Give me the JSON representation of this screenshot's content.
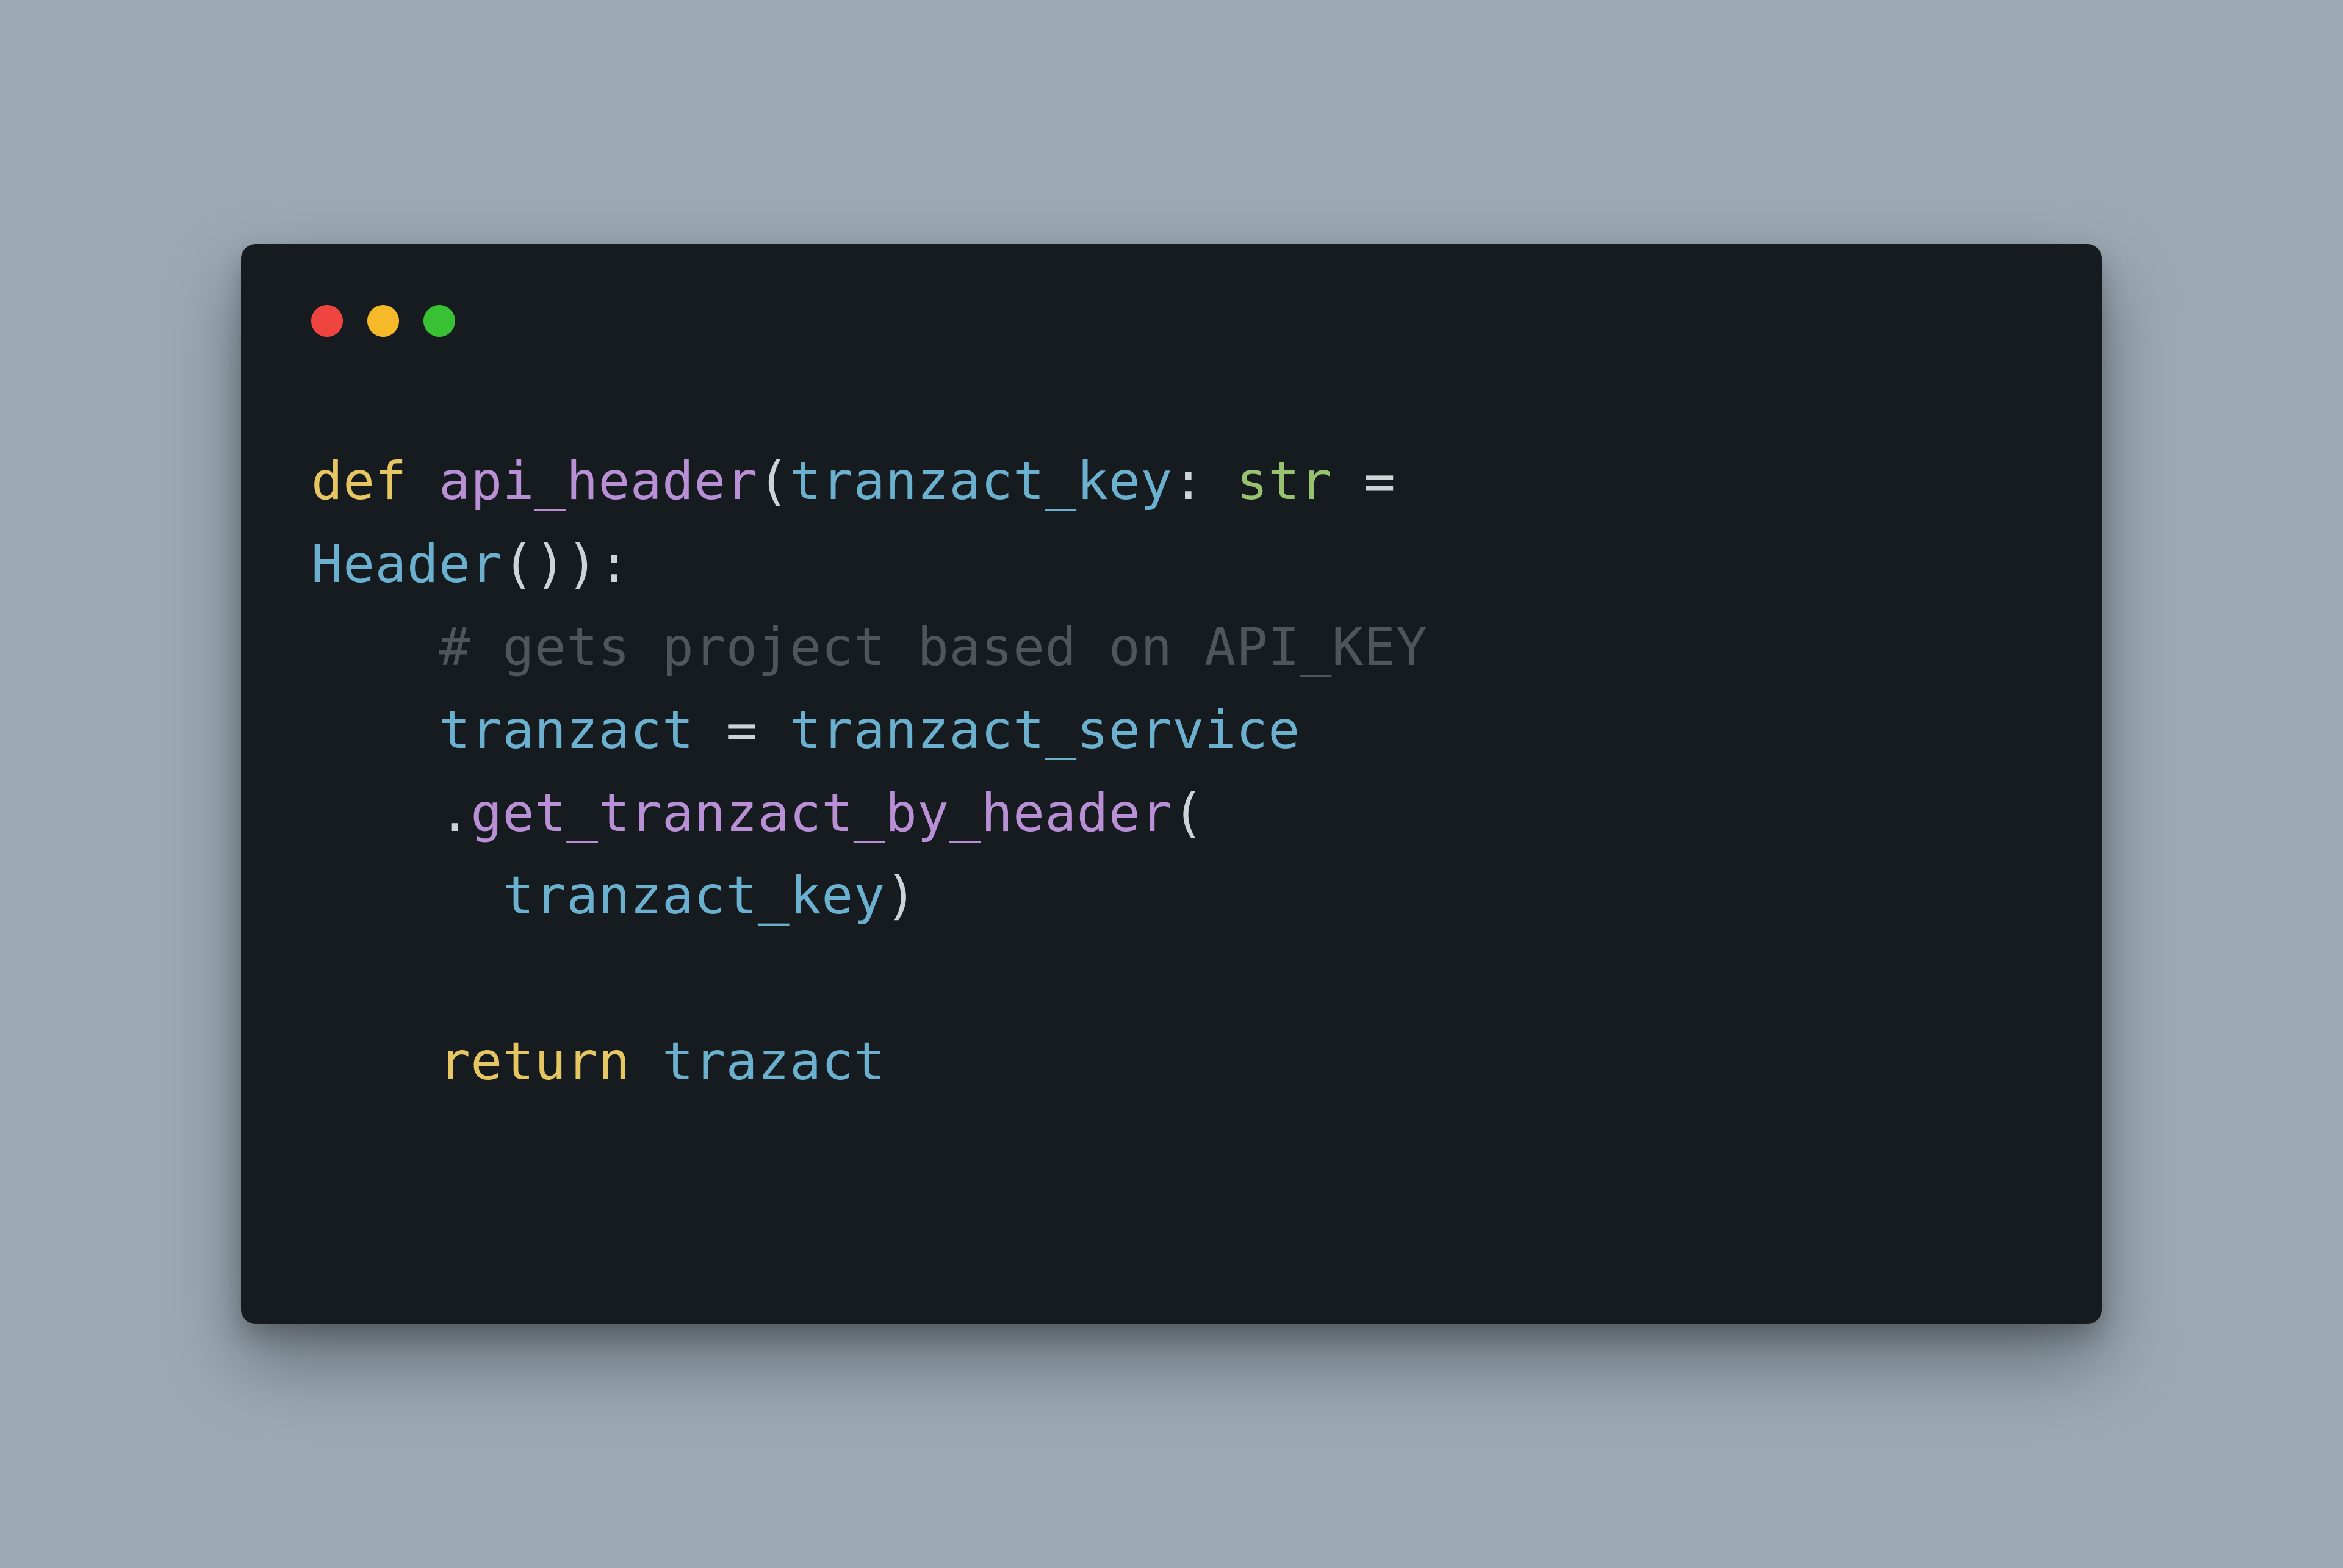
{
  "colors": {
    "background": "#9ba9b4",
    "window_bg": "#151b1e",
    "traffic_close": "#ef443f",
    "traffic_minimize": "#f5b929",
    "traffic_maximize": "#38c132",
    "keyword": "#e6c663",
    "function": "#b98fd6",
    "identifier": "#6bb1cf",
    "type": "#97c26f",
    "punct": "#cfd3d6",
    "comment": "#4f565a"
  },
  "code": {
    "line1": {
      "kw_def": "def",
      "fn_name": "api_header",
      "paren_open": "(",
      "param": "tranzact_key",
      "colon": ": ",
      "type": "str",
      "eq": " = "
    },
    "line2": {
      "cls": "Header",
      "call": "()):"
    },
    "line3": {
      "indent": "    ",
      "comment": "# gets project based on API_KEY"
    },
    "line4": {
      "indent": "    ",
      "var": "tranzact",
      "eq": " = ",
      "svc": "tranzact_service"
    },
    "line5": {
      "indent": "    ",
      "dot": ".",
      "method": "get_tranzact_by_header",
      "paren": "("
    },
    "line6": {
      "indent": "      ",
      "arg": "tranzact_key",
      "close": ")"
    },
    "line7": {
      "blank": " "
    },
    "line8": {
      "indent": "    ",
      "kw_return": "return",
      "sp": " ",
      "val": "trazact"
    }
  }
}
